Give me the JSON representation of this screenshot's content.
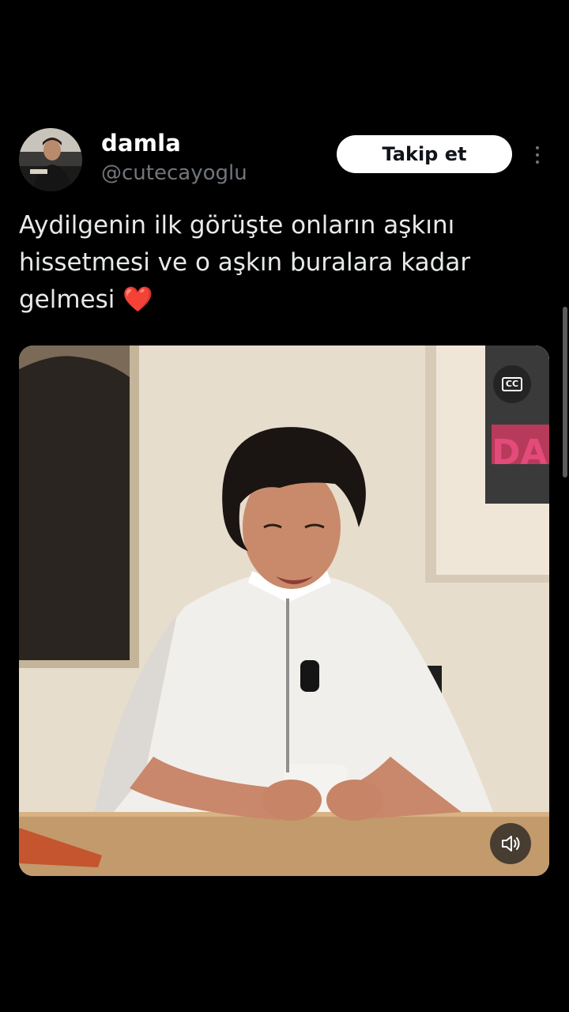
{
  "user": {
    "display_name": "damla",
    "handle": "@cutecayoglu"
  },
  "actions": {
    "follow_label": "Takip et",
    "more_icon": "more-vertical-icon"
  },
  "tweet": {
    "text": "Aydilgenin ilk görüşte onların aşkını hissetmesi ve o aşkın buralara kadar gelmesi",
    "emoji": "❤️"
  },
  "media": {
    "type": "video",
    "captions_label": "CC",
    "sound_icon": "speaker-icon",
    "poster_text": "DA"
  },
  "colors": {
    "background": "#000000",
    "text": "#e7e9ea",
    "secondary": "#71767b",
    "follow_bg": "#ffffff",
    "heart": "#f91880"
  }
}
